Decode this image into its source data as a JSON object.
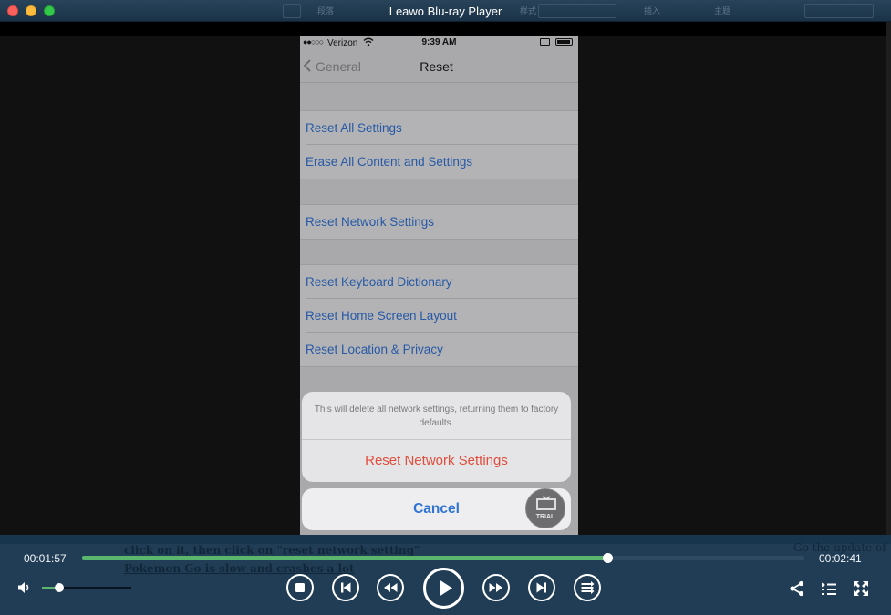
{
  "window": {
    "title": "Leawo Blu-ray Player",
    "background_menu_ghosts": [
      "段落",
      "样式",
      "插入",
      "主题"
    ]
  },
  "phone": {
    "status_bar": {
      "signal": "●●○○○",
      "carrier": "Verizon",
      "time": "9:39 AM"
    },
    "nav": {
      "back_label": "General",
      "title": "Reset"
    },
    "groups": [
      {
        "items": [
          "Reset All Settings",
          "Erase All Content and Settings"
        ]
      },
      {
        "items": [
          "Reset Network Settings"
        ]
      },
      {
        "items": [
          "Reset Keyboard Dictionary",
          "Reset Home Screen Layout",
          "Reset Location & Privacy"
        ]
      }
    ],
    "alert": {
      "message": "This will delete all network settings, returning them to factory defaults.",
      "action": "Reset Network Settings",
      "cancel": "Cancel"
    },
    "trial_badge": "TRIAL"
  },
  "background_document": {
    "line1": "click on it,    then click on \"reset network setting\"",
    "line2": "Pokemon Go is slow and crashes a lot",
    "right_fragment": "Go the update of"
  },
  "player": {
    "current_time": "00:01:57",
    "total_time": "00:02:41",
    "progress_fraction": 0.7267,
    "volume_fraction": 0.19,
    "accent_color": "#5ab66d"
  },
  "icons": {
    "volume": "speaker-icon",
    "stop": "stop-icon",
    "previous": "skip-previous-icon",
    "rewind": "rewind-icon",
    "play": "play-icon",
    "forward": "fast-forward-icon",
    "next": "skip-next-icon",
    "playlist_mode": "repeat-list-icon",
    "share": "share-icon",
    "playlist": "playlist-icon",
    "fullscreen": "fullscreen-icon"
  }
}
